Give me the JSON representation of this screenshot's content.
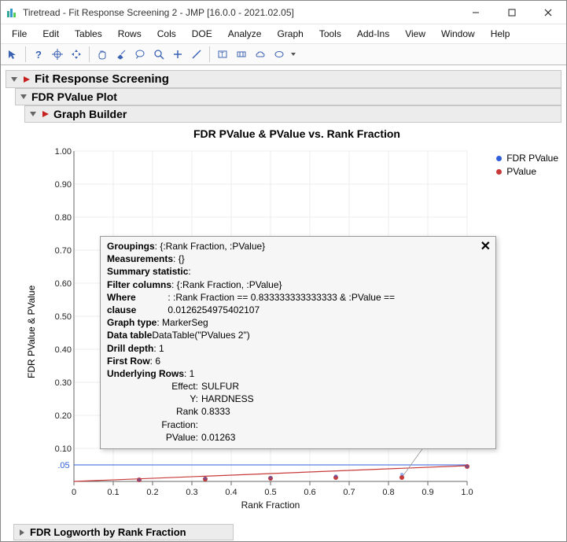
{
  "window": {
    "title": "Tiretread - Fit Response Screening 2 - JMP [16.0.0 - 2021.02.05]"
  },
  "menu": {
    "file": "File",
    "edit": "Edit",
    "tables": "Tables",
    "rows": "Rows",
    "cols": "Cols",
    "doe": "DOE",
    "analyze": "Analyze",
    "graph": "Graph",
    "tools": "Tools",
    "addins": "Add-Ins",
    "view": "View",
    "window": "Window",
    "help": "Help"
  },
  "sections": {
    "main": "Fit Response Screening",
    "fdr_plot": "FDR PValue Plot",
    "graph_builder": "Graph Builder",
    "logworth": "FDR Logworth by Rank Fraction"
  },
  "chart": {
    "title": "FDR PValue & PValue vs. Rank Fraction",
    "ylabel": "FDR PValue & PValue",
    "xlabel": "Rank Fraction",
    "legend": {
      "fdr": "FDR PValue",
      "pv": "PValue"
    },
    "ref_label": ".05",
    "colors": {
      "fdr": "#2f5fd8",
      "pv": "#c83a3a"
    }
  },
  "chart_data": {
    "type": "scatter",
    "xlabel": "Rank Fraction",
    "ylabel": "FDR PValue & PValue",
    "xlim": [
      0,
      1.0
    ],
    "ylim": [
      0,
      1.0
    ],
    "x_ticks": [
      0,
      0.1,
      0.2,
      0.3,
      0.4,
      0.5,
      0.6,
      0.7,
      0.8,
      0.9,
      1.0
    ],
    "y_ticks": [
      0.1,
      0.2,
      0.3,
      0.4,
      0.5,
      0.6,
      0.7,
      0.8,
      0.9,
      1.0
    ],
    "reference_line_y": 0.05,
    "series": [
      {
        "name": "FDR PValue",
        "color": "#2f5fd8",
        "line": [
          [
            0,
            0.0
          ],
          [
            1.0,
            0.05
          ]
        ],
        "points": [
          {
            "x": 0.1667,
            "y": 0.004
          },
          {
            "x": 0.3333,
            "y": 0.01
          },
          {
            "x": 0.5,
            "y": 0.012
          },
          {
            "x": 0.6667,
            "y": 0.016
          },
          {
            "x": 0.8333,
            "y": 0.022
          },
          {
            "x": 1.0,
            "y": 0.046
          }
        ]
      },
      {
        "name": "PValue",
        "color": "#c83a3a",
        "line": [
          [
            0,
            0.0
          ],
          [
            1.0,
            0.047
          ]
        ],
        "points": [
          {
            "x": 0.1667,
            "y": 0.001
          },
          {
            "x": 0.3333,
            "y": 0.004
          },
          {
            "x": 0.5,
            "y": 0.006
          },
          {
            "x": 0.6667,
            "y": 0.01
          },
          {
            "x": 0.8333,
            "y": 0.01263
          },
          {
            "x": 1.0,
            "y": 0.046
          }
        ]
      }
    ]
  },
  "hover": {
    "groupings_k": "Groupings",
    "groupings_v": ": {:Rank Fraction, :PValue}",
    "meas_k": "Measurements",
    "meas_v": ": {}",
    "sumstat_k": "Summary statistic",
    "sumstat_v": ":",
    "filter_k": "Filter columns",
    "filter_v": ": {:Rank Fraction, :PValue}",
    "where_k": "Where clause",
    "where_v": ": :Rank Fraction == 0.833333333333333 & :PValue == 0.0126254975402107",
    "gtype_k": "Graph type",
    "gtype_v": ": MarkerSeg",
    "dtable_k": "Data table",
    "dtable_v": " DataTable(\"PValues 2\")",
    "drill_k": "Drill depth",
    "drill_v": ": 1",
    "frow_k": "First Row",
    "frow_v": ": 6",
    "urows_k": "Underlying Rows",
    "urows_v": ": 1",
    "effect_k": "Effect:",
    "effect_v": "SULFUR",
    "y_k": "Y:",
    "y_v": "HARDNESS",
    "rf_k": "Rank Fraction:",
    "rf_v": "0.8333",
    "pv_k": "PValue:",
    "pv_v": "0.01263"
  }
}
